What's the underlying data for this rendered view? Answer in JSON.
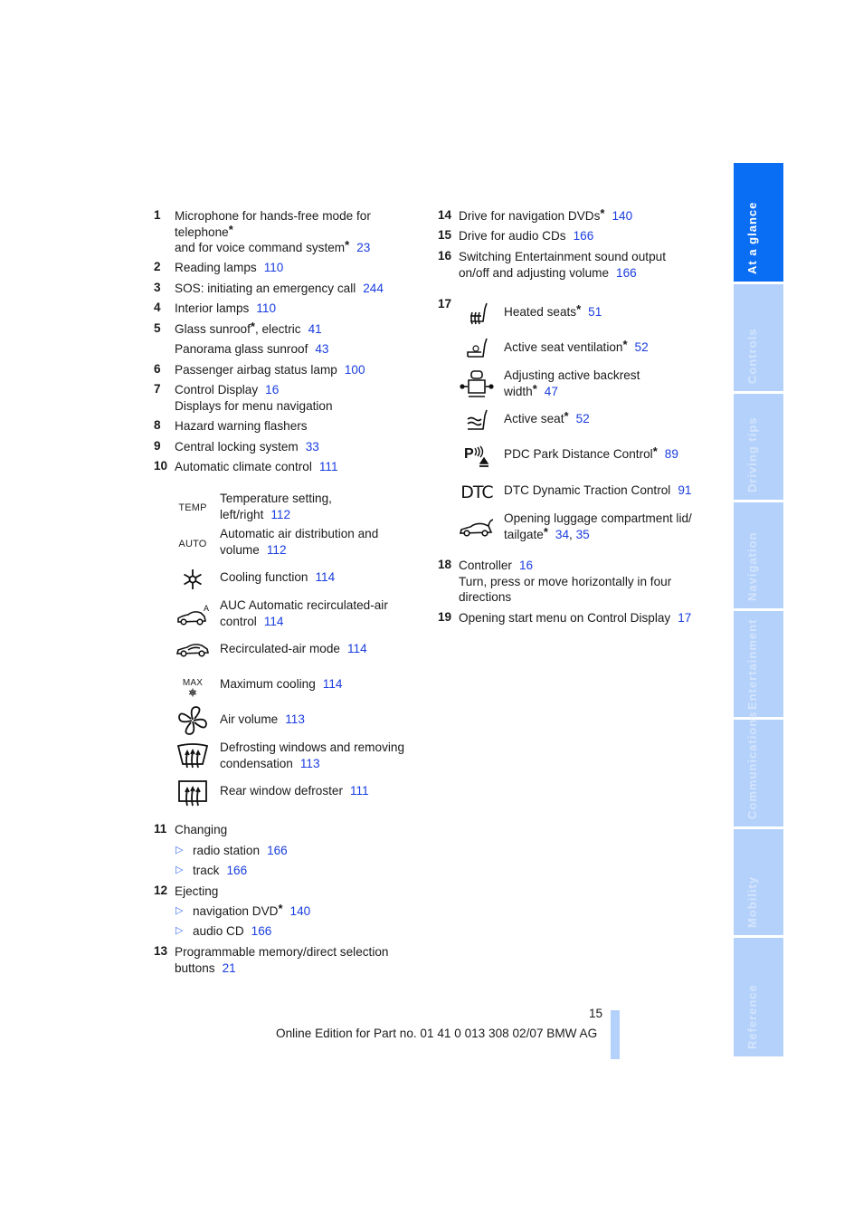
{
  "left_column": {
    "items": [
      {
        "num": "1",
        "lines": [
          "Microphone for hands-free mode for",
          "telephone",
          "and for voice command system"
        ],
        "page": "23"
      },
      {
        "num": "2",
        "text": "Reading lamps",
        "page": "110"
      },
      {
        "num": "3",
        "text": "SOS: initiating an emergency call",
        "page": "244"
      },
      {
        "num": "4",
        "text": "Interior lamps",
        "page": "110"
      },
      {
        "num": "5",
        "text": "Glass sunroof",
        "text_after": ", electric",
        "page": "41"
      },
      {
        "num": "",
        "text": "Panorama glass sunroof",
        "page": "43"
      },
      {
        "num": "6",
        "text": "Passenger airbag status lamp",
        "page": "100"
      },
      {
        "num": "7",
        "text": "Control Display",
        "page": "16",
        "subtext": "Displays for menu navigation"
      },
      {
        "num": "8",
        "text": "Hazard warning flashers"
      },
      {
        "num": "9",
        "text": "Central locking system",
        "page": "33"
      },
      {
        "num": "10",
        "text": "Automatic climate control",
        "page": "111"
      }
    ],
    "climate_items": [
      {
        "icon": "temp-icon",
        "icon_text": "TEMP",
        "lines": [
          "Temperature setting,",
          "left/right"
        ],
        "page": "112"
      },
      {
        "icon": "auto-icon",
        "icon_text": "AUTO",
        "lines": [
          "Automatic air distribution and",
          "volume"
        ],
        "page": "112"
      },
      {
        "icon": "snowflake-icon",
        "lines": [
          "Cooling function"
        ],
        "page": "114"
      },
      {
        "icon": "auc-car-icon",
        "icon_text": "A",
        "lines": [
          "AUC Automatic recirculated-air",
          "control"
        ],
        "page": "114"
      },
      {
        "icon": "recirculation-car-icon",
        "lines": [
          "Recirculated-air mode"
        ],
        "page": "114"
      },
      {
        "icon": "max-cooling-icon",
        "icon_text": "MAX",
        "lines": [
          "Maximum cooling"
        ],
        "page": "114"
      },
      {
        "icon": "fan-icon",
        "lines": [
          "Air volume"
        ],
        "page": "113"
      },
      {
        "icon": "windshield-defrost-icon",
        "lines": [
          "Defrosting windows and removing",
          "condensation"
        ],
        "page": "113"
      },
      {
        "icon": "rear-defrost-icon",
        "lines": [
          "Rear window defroster"
        ],
        "page": "111"
      }
    ],
    "item11": {
      "num": "11",
      "text": "Changing",
      "bullets": [
        {
          "text": "radio station",
          "page": "166"
        },
        {
          "text": "track",
          "page": "166"
        }
      ]
    },
    "item12": {
      "num": "12",
      "text": "Ejecting",
      "bullets": [
        {
          "text": "navigation DVD",
          "star": true,
          "page": "140"
        },
        {
          "text": "audio CD",
          "page": "166"
        }
      ]
    },
    "item13": {
      "num": "13",
      "lines": [
        "Programmable memory/direct selection",
        "buttons"
      ],
      "page": "21"
    }
  },
  "right_column": {
    "item14": {
      "num": "14",
      "text": "Drive for navigation DVDs",
      "page": "140"
    },
    "item15": {
      "num": "15",
      "text": "Drive for audio CDs",
      "page": "166"
    },
    "item16": {
      "num": "16",
      "lines": [
        "Switching Entertainment sound output",
        "on/off and adjusting volume"
      ],
      "page": "166"
    },
    "item17": {
      "num": "17",
      "entries": [
        {
          "icon": "heated-seat-icon",
          "lines": [
            "Heated seats"
          ],
          "star": true,
          "page": "51"
        },
        {
          "icon": "seat-ventilation-icon",
          "lines": [
            "Active seat ventilation"
          ],
          "star": true,
          "page": "52"
        },
        {
          "icon": "backrest-width-icon",
          "lines": [
            "Adjusting active backrest",
            "width"
          ],
          "star": true,
          "page": "47"
        },
        {
          "icon": "active-seat-icon",
          "lines": [
            "Active seat"
          ],
          "star": true,
          "page": "52"
        },
        {
          "icon": "pdc-icon",
          "icon_text": "P",
          "lines": [
            "PDC Park Distance Control"
          ],
          "star": true,
          "page": "89"
        },
        {
          "icon": "dtc-icon",
          "icon_text": "DTC",
          "lines": [
            "DTC Dynamic Traction Control"
          ],
          "page": "91"
        },
        {
          "icon": "tailgate-car-icon",
          "lines": [
            "Opening luggage compartment lid/",
            "tailgate"
          ],
          "star": true,
          "pages": [
            "34",
            "35"
          ]
        }
      ]
    },
    "item18": {
      "num": "18",
      "text": "Controller",
      "page": "16",
      "sublines": [
        "Turn, press or move horizontally in four",
        "directions"
      ]
    },
    "item19": {
      "num": "19",
      "text": "Opening start menu on Control Display",
      "page": "17"
    }
  },
  "sidebar": {
    "tabs": [
      {
        "label": "At a glance",
        "active": true
      },
      {
        "label": "Controls"
      },
      {
        "label": "Driving tips"
      },
      {
        "label": "Navigation"
      },
      {
        "label": "Entertainment"
      },
      {
        "label": "Communications"
      },
      {
        "label": "Mobility"
      },
      {
        "label": "Reference"
      }
    ]
  },
  "footer": {
    "page_number": "15",
    "edition": "Online Edition for Part no. 01 41 0 013 308 02/07 BMW AG"
  },
  "colors": {
    "link": "#1a3de0",
    "tab_active": "#0a6ef5",
    "tab_inactive": "#b3d1fb",
    "bullet": "#3a6cf0"
  },
  "star_symbol": "*",
  "bullet_symbol": "▷",
  "comma": ","
}
